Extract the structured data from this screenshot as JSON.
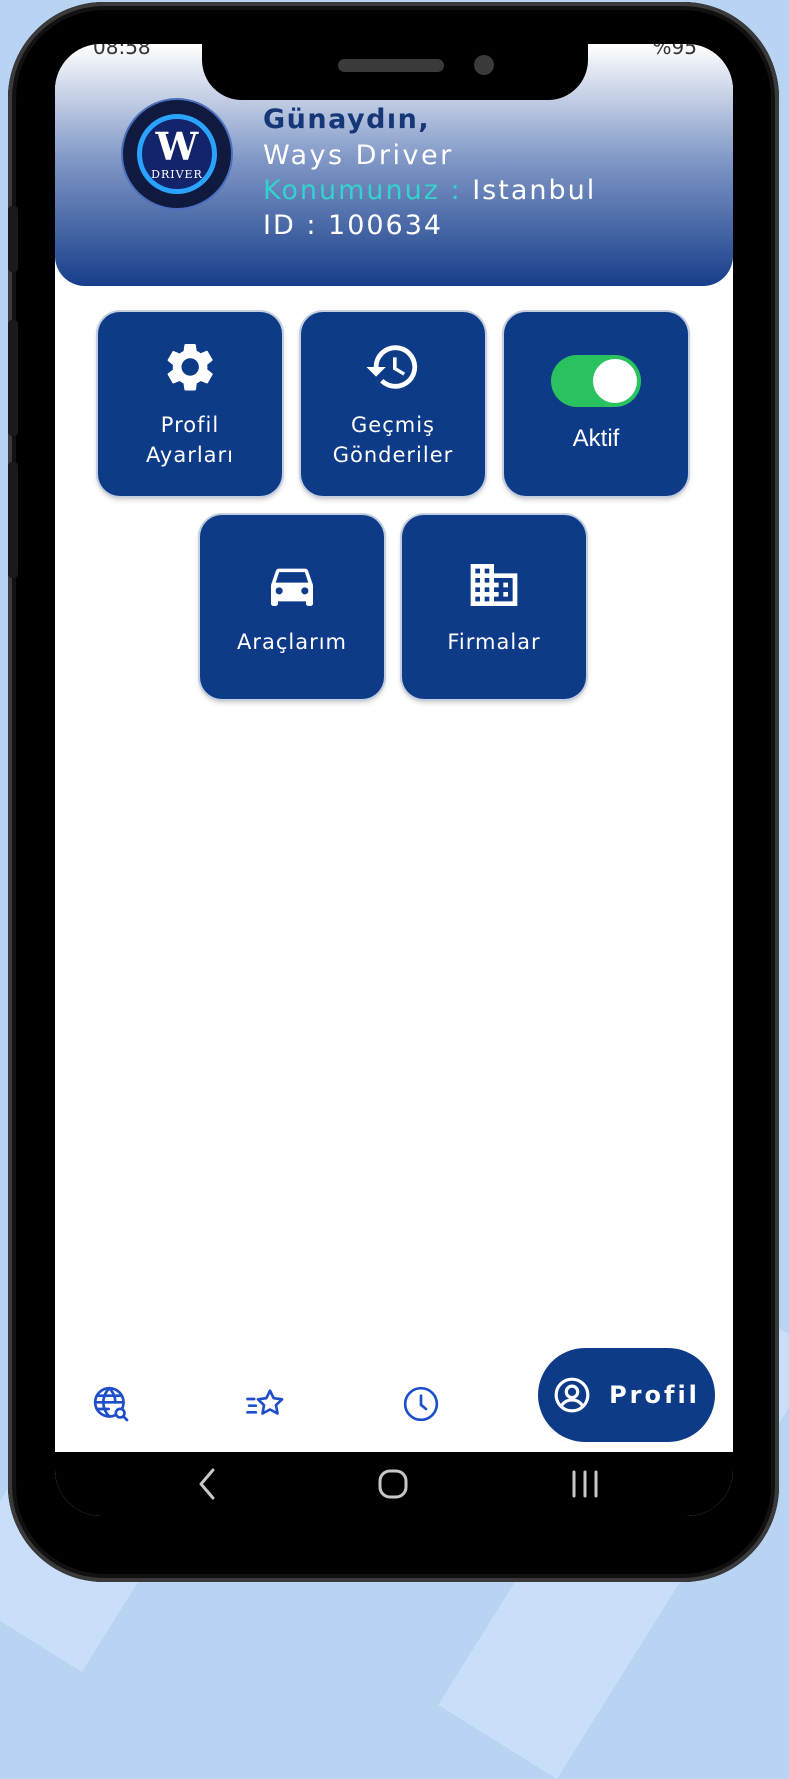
{
  "status_bar": {
    "time": "08:58",
    "battery": "%95"
  },
  "header": {
    "greeting": "Günaydın,",
    "user_name": "Ways Driver",
    "location_label": "Konumunuz :",
    "location_value": "Istanbul",
    "id_text": "ID : 100634",
    "logo_letter": "W",
    "logo_text": "DRIVER"
  },
  "tiles": [
    {
      "label_line1": "Profil",
      "label_line2": "Ayarları",
      "icon": "gear-icon"
    },
    {
      "label_line1": "Geçmiş",
      "label_line2": "Gönderiler",
      "icon": "history-icon"
    },
    {
      "label": "Aktif",
      "icon": "toggle-switch",
      "state": "on"
    },
    {
      "label": "Araçlarım",
      "icon": "car-icon"
    },
    {
      "label": "Firmalar",
      "icon": "building-icon"
    }
  ],
  "bottom_nav": {
    "items": [
      "globe-search-icon",
      "star-list-icon",
      "clock-icon"
    ],
    "active_label": "Profil",
    "active_icon": "user-circle-icon"
  },
  "colors": {
    "primary": "#0e3b87",
    "accent_teal": "#34d1ce",
    "toggle_on": "#29c25f"
  }
}
